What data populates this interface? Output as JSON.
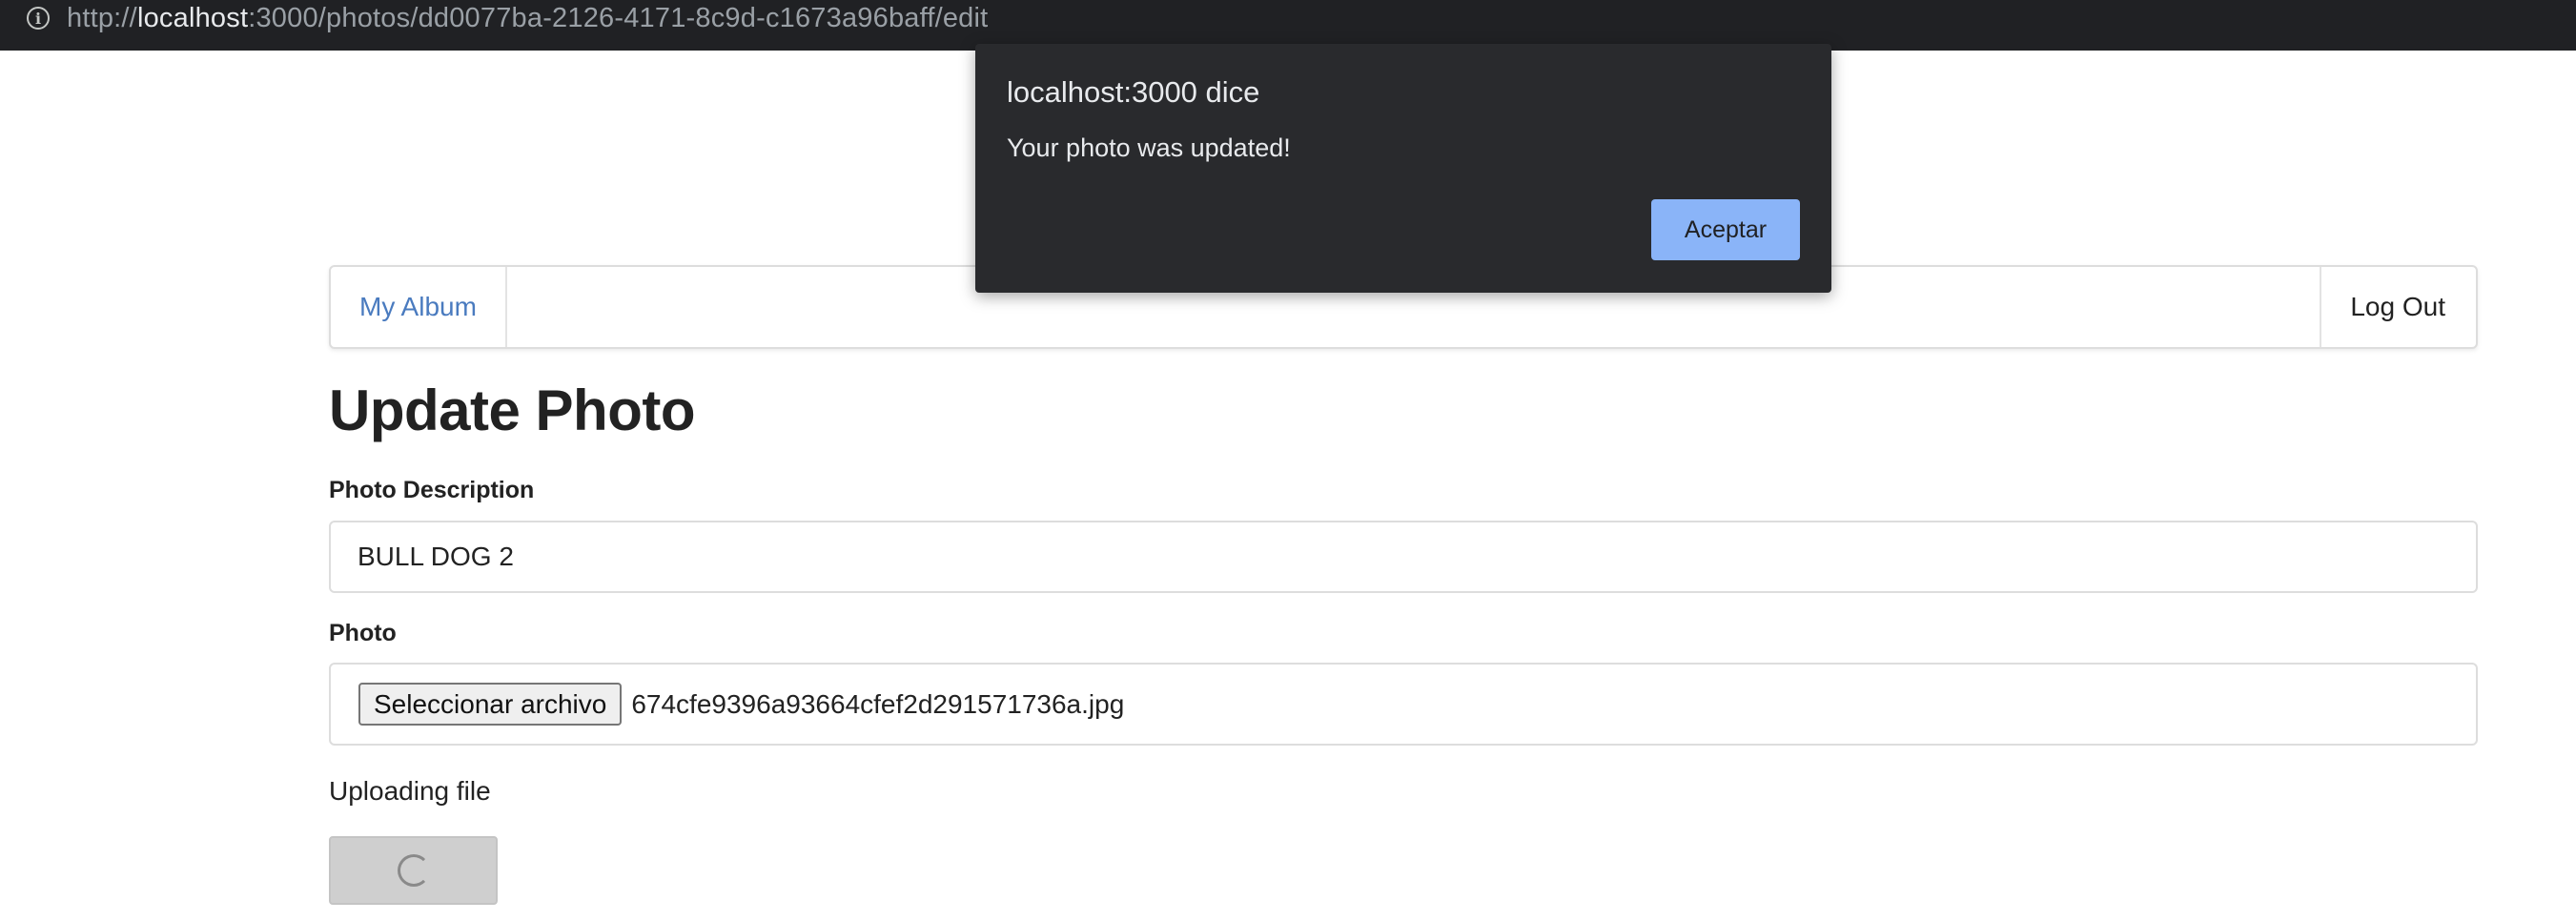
{
  "browser": {
    "url_prefix": "http://",
    "url_host": "localhost",
    "url_rest": ":3000/photos/dd0077ba-2126-4171-8c9d-c1673a96baff/edit",
    "info_icon": "i"
  },
  "navbar": {
    "album_link": "My Album",
    "logout_link": "Log Out"
  },
  "page": {
    "title": "Update Photo"
  },
  "form": {
    "description_label": "Photo Description",
    "description_value": "BULL DOG 2",
    "photo_label": "Photo",
    "file_button_label": "Seleccionar archivo",
    "file_name": "674cfe9396a93664cfef2d291571736a.jpg",
    "uploading_text": "Uploading file"
  },
  "alert": {
    "title": "localhost:3000 dice",
    "message": "Your photo was updated!",
    "ok_label": "Aceptar"
  },
  "colors": {
    "link": "#4a7bbf",
    "dialog_bg": "#292a2d",
    "dialog_button": "#8ab4f8"
  }
}
